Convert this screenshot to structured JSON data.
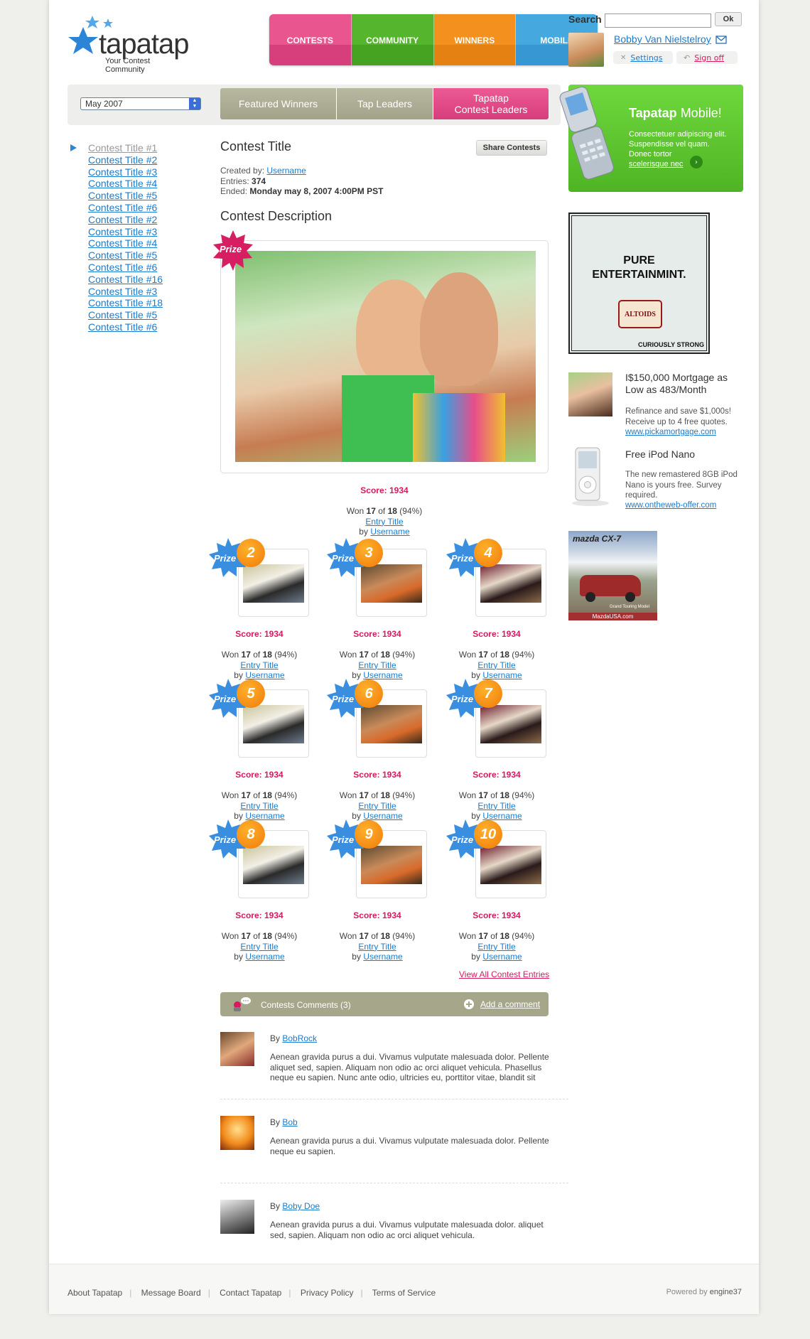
{
  "brand": {
    "name": "tapatap",
    "tagline": "Your Contest Community",
    "colors": {
      "pink": "#e04a8a",
      "green": "#4fb424",
      "orange": "#f08a1a",
      "blue": "#3aa2dc"
    }
  },
  "nav": [
    {
      "label": "CONTESTS",
      "color": "#e04a86"
    },
    {
      "label": "COMMUNITY",
      "color": "#4fae28"
    },
    {
      "label": "WINNERS",
      "color": "#f08a18"
    },
    {
      "label": "MOBILE",
      "color": "#3fa3dc"
    }
  ],
  "search": {
    "label": "Search",
    "placeholder": "",
    "button": "Ok"
  },
  "user": {
    "name": "Bobby Van Nielstelroy",
    "settings": "Settings",
    "signoff": "Sign off"
  },
  "filter": {
    "month": "May 2007"
  },
  "tabs": [
    {
      "label": "Featured Winners"
    },
    {
      "label": "Tap Leaders"
    },
    {
      "label": "Tapatap\nContest Leaders"
    }
  ],
  "contest_list": [
    "Contest Title #1",
    "Contest Title #2",
    "Contest Title #3",
    "Contest Title #4",
    "Contest Title #5",
    "Contest Title #6",
    "Contest Title #2",
    "Contest Title #3",
    "Contest Title #4",
    "Contest Title #5",
    "Contest Title #6",
    "Contest Title #16",
    "Contest Title #3",
    "Contest Title #18",
    "Contest Title #5",
    "Contest Title #6"
  ],
  "contest": {
    "title": "Contest Title",
    "share": "Share Contests",
    "created_by_label": "Created by:",
    "created_by": "Username",
    "entries_label": "Entries:",
    "entries": "374",
    "ended_label": "Ended:",
    "ended": "Monday may 8, 2007 4:00PM PST",
    "description_heading": "Contest Description",
    "prize_label": "Prize"
  },
  "main_entry": {
    "score": "Score: 1934",
    "won_prefix": "Won",
    "won_a": "17",
    "won_of": "of",
    "won_b": "18",
    "won_pct": "(94%)",
    "title": "Entry Title",
    "by": "by",
    "user": "Username"
  },
  "entries": [
    {
      "rank": "2"
    },
    {
      "rank": "3"
    },
    {
      "rank": "4"
    },
    {
      "rank": "5"
    },
    {
      "rank": "6"
    },
    {
      "rank": "7"
    },
    {
      "rank": "8"
    },
    {
      "rank": "9"
    },
    {
      "rank": "10"
    }
  ],
  "entry_common": {
    "prize": "Prize",
    "score": "Score: 1934",
    "won_prefix": "Won",
    "won_a": "17",
    "won_of": "of",
    "won_b": "18",
    "won_pct": "(94%)",
    "title": "Entry Title",
    "by": "by",
    "user": "Username"
  },
  "view_all": "View All Contest Entries",
  "comments": {
    "header": "Contests Comments (3)",
    "add": "Add a comment",
    "by": "By",
    "items": [
      {
        "user": "BobRock",
        "text": "Aenean gravida purus a dui. Vivamus vulputate malesuada dolor. Pellente aliquet sed, sapien. Aliquam non odio ac orci aliquet vehicula. Phasellus neque eu sapien. Nunc ante odio, ultricies eu, porttitor vitae, blandit sit"
      },
      {
        "user": "Bob",
        "text": "Aenean gravida purus a dui. Vivamus vulputate malesuada dolor. Pellente neque eu sapien."
      },
      {
        "user": "Boby Doe",
        "text": "Aenean gravida purus a dui. Vivamus vulputate malesuada dolor. aliquet sed, sapien. Aliquam non odio ac orci aliquet vehicula."
      }
    ]
  },
  "promo": {
    "title_bold": "Tapatap",
    "title_rest": " Mobile!",
    "line1": "Consectetuer adipiscing elit.",
    "line2": "Suspendisse vel quam.",
    "line3": "Donec tortor",
    "link": "scelerisque nec"
  },
  "ads": {
    "altoids": {
      "line1": "PURE",
      "line2": "ENTERTAINMINT.",
      "brand": "ALTOIDS",
      "slogan": "CURIOUSLY STRONG"
    },
    "mortgage": {
      "title": "I$150,000 Mortgage as Low as 483/Month",
      "body": "Refinance and save $1,000s! Receive up to 4 free quotes.",
      "link": "www.pickamortgage.com"
    },
    "ipod": {
      "title": "Free iPod Nano",
      "body": "The new remastered 8GB iPod Nano is yours free. Survey required.",
      "link": "www.ontheweb-offer.com"
    },
    "mazda": {
      "brand": "mazda CX-7",
      "caption": "Grand Touring Model",
      "footer": "MazdaUSA.com"
    }
  },
  "footer": {
    "links": [
      "About Tapatap",
      "Message Board",
      "Contact Tapatap",
      "Privacy Policy",
      "Terms of Service"
    ],
    "powered_prefix": "Powered by",
    "powered_brand": "engine37"
  }
}
